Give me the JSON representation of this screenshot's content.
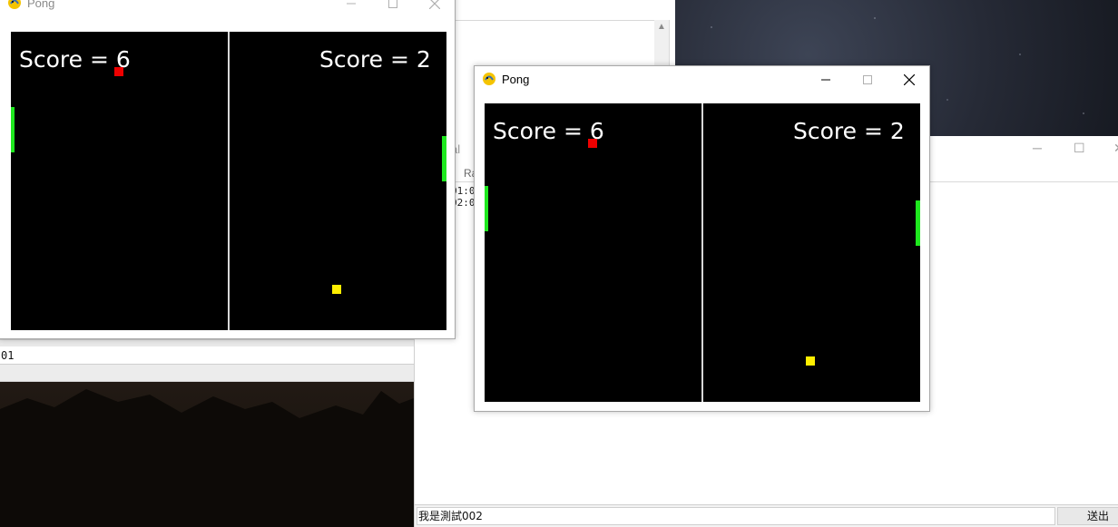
{
  "colors": {
    "paddle": "#1ee81e",
    "ball_red": "#ee0000",
    "ball_yellow": "#ffee00",
    "field": "#000000",
    "divider": "#d8d8d8"
  },
  "pong_windows": [
    {
      "title": "Pong",
      "state": "inactive",
      "left_score": "Score = 6",
      "right_score": "Score = 2"
    },
    {
      "title": "Pong",
      "state": "active",
      "left_score": "Score = 6",
      "right_score": "Score = 2"
    }
  ],
  "chat_window": {
    "input_text": "01"
  },
  "terminal_window": {
    "title_fragment": "al",
    "menu_fragment": "Ra",
    "log_lines": [
      "01:0",
      "02:0"
    ],
    "message_input": "我是測試002",
    "send_label": "送出"
  }
}
